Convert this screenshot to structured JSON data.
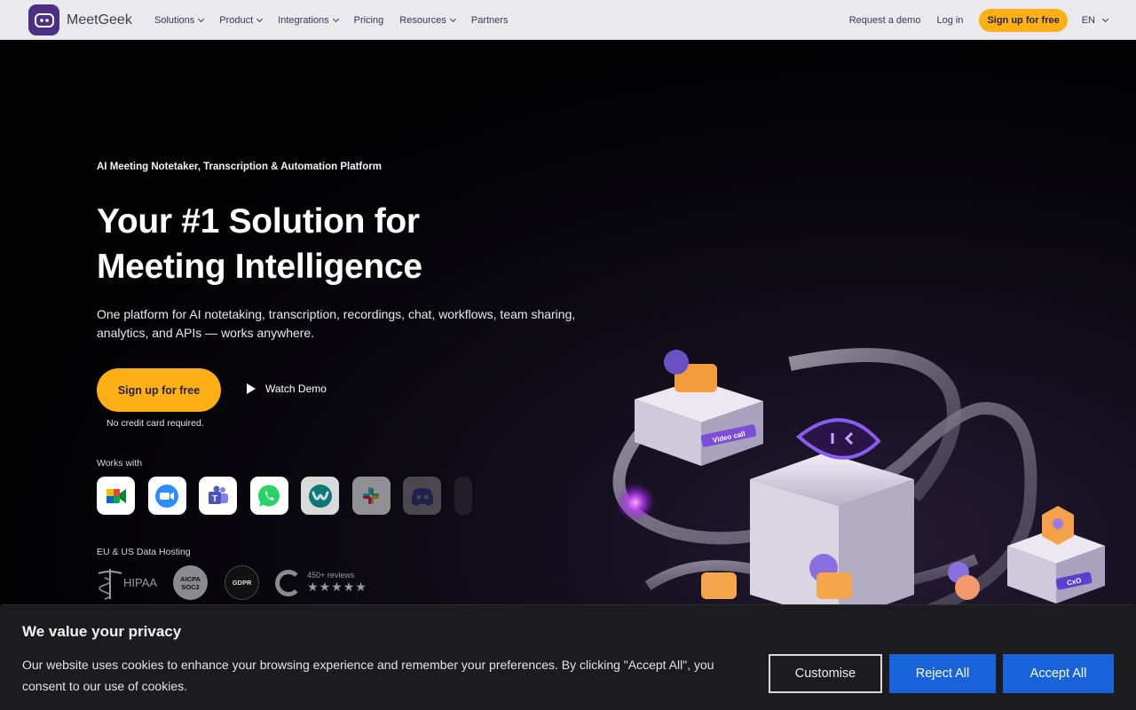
{
  "nav": {
    "brand": "MeetGeek",
    "menu": [
      {
        "label": "Solutions",
        "has_dropdown": true
      },
      {
        "label": "Product",
        "has_dropdown": true
      },
      {
        "label": "Integrations",
        "has_dropdown": true
      },
      {
        "label": "Pricing",
        "has_dropdown": false
      },
      {
        "label": "Resources",
        "has_dropdown": true
      },
      {
        "label": "Partners",
        "has_dropdown": false
      }
    ],
    "request_demo": "Request a demo",
    "login": "Log in",
    "signup": "Sign up for free",
    "language": "EN"
  },
  "hero": {
    "tagline": "AI Meeting Notetaker, Transcription & Automation Platform",
    "headline_line1": "Your #1 Solution for",
    "headline_line2": "Meeting Intelligence",
    "subtext": "One platform for AI notetaking, transcription, recordings, chat, workflows, team sharing, analytics, and APIs — works anywhere.",
    "signup_button": "Sign up for free",
    "watch_demo": "Watch Demo",
    "no_credit_card": "No credit card required.",
    "works_with_label": "Works with",
    "apps": [
      "google-meet-icon",
      "zoom-icon",
      "microsoft-teams-icon",
      "whatsapp-icon",
      "webex-icon",
      "slack-icon",
      "discord-icon",
      "more-app-icon"
    ],
    "hosting_label": "EU & US Data Hosting",
    "badges": {
      "hipaa": "HIPAA",
      "aicpa_line1": "AICPA",
      "aicpa_line2": "SOC2",
      "gdpr": "GDPR",
      "g2_reviews": "450+ reviews",
      "g2_stars": "★★★★★"
    },
    "illustration_labels": {
      "video_call": "Video call",
      "cxo": "CxO"
    }
  },
  "cookie": {
    "title": "We value your privacy",
    "text": "Our website uses cookies to enhance your browsing experience and remember your preferences. By clicking \"Accept All\", you consent to our use of cookies.",
    "customise": "Customise",
    "reject": "Reject All",
    "accept": "Accept All"
  },
  "colors": {
    "accent_yellow": "#fcb016",
    "brand_purple": "#4d2f86",
    "cookie_blue": "#1863dc"
  }
}
